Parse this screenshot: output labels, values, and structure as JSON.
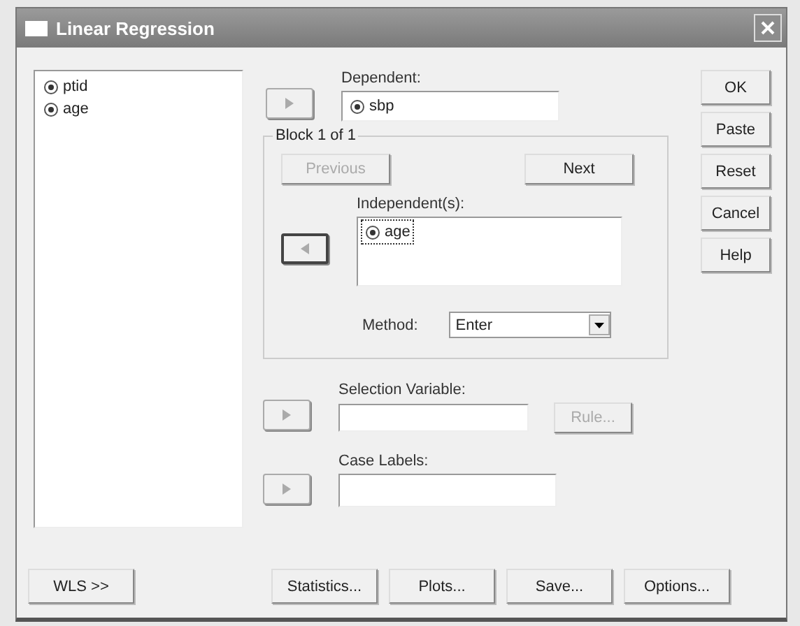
{
  "window": {
    "title": "Linear Regression"
  },
  "variables": [
    {
      "name": "ptid",
      "selected": false
    },
    {
      "name": "age",
      "selected": false
    }
  ],
  "dependent": {
    "label": "Dependent:",
    "arrow": {
      "kind": "right",
      "focused": false
    },
    "items": [
      {
        "name": "sbp",
        "selected": false
      }
    ]
  },
  "block": {
    "title": "Block 1 of 1",
    "previous": {
      "label": "Previous",
      "disabled": true
    },
    "next": {
      "label": "Next",
      "disabled": false
    },
    "independent": {
      "label": "Independent(s):",
      "arrow": {
        "kind": "left",
        "focused": true
      },
      "items": [
        {
          "name": "age",
          "selected": true
        }
      ]
    },
    "method": {
      "label": "Method:",
      "value": "Enter"
    }
  },
  "selection": {
    "label": "Selection Variable:",
    "arrow": {
      "kind": "right",
      "focused": false
    },
    "rule": {
      "label": "Rule...",
      "disabled": true
    }
  },
  "case_labels": {
    "label": "Case Labels:",
    "arrow": {
      "kind": "right",
      "focused": false
    }
  },
  "side_buttons": [
    {
      "label": "OK"
    },
    {
      "label": "Paste"
    },
    {
      "label": "Reset"
    },
    {
      "label": "Cancel"
    },
    {
      "label": "Help"
    }
  ],
  "wls_button": {
    "label": "WLS >>"
  },
  "bottom_buttons": [
    {
      "label": "Statistics..."
    },
    {
      "label": "Plots..."
    },
    {
      "label": "Save..."
    },
    {
      "label": "Options..."
    }
  ]
}
